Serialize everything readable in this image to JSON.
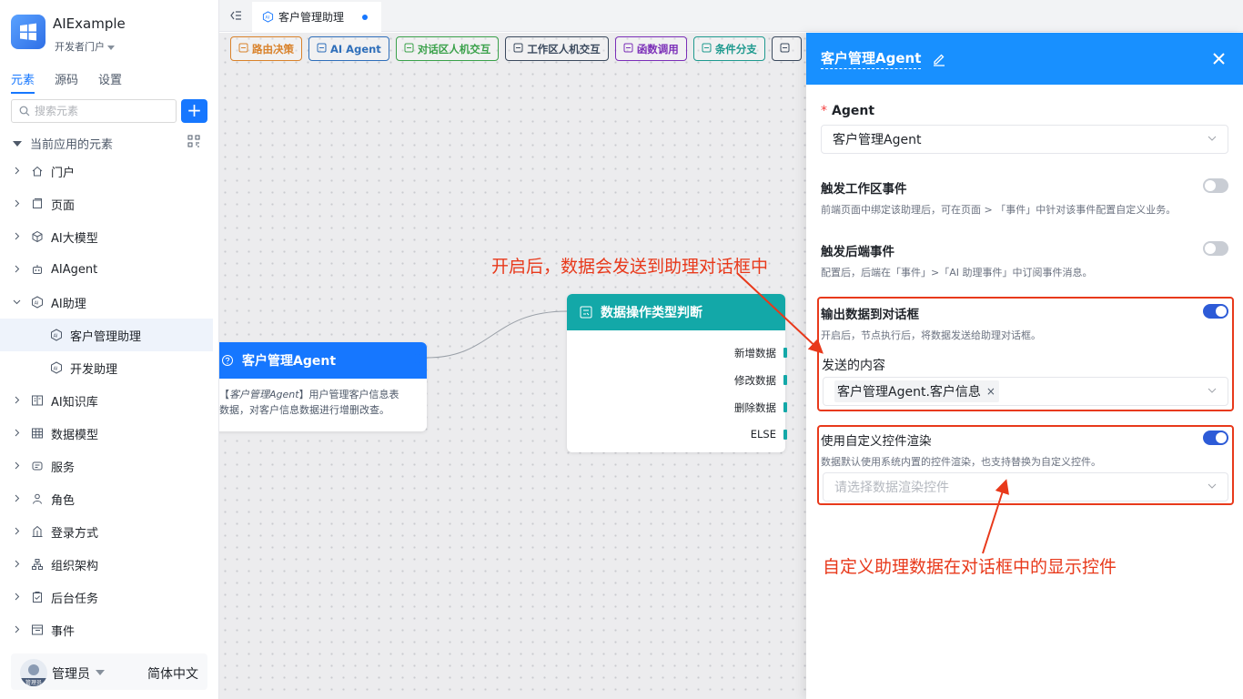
{
  "app": {
    "name": "AIExample",
    "portal": "开发者门户"
  },
  "sidebar": {
    "tabs": [
      "元素",
      "源码",
      "设置"
    ],
    "search_placeholder": "搜索元素",
    "add_label": "+",
    "section_title": "当前应用的元素",
    "items": [
      {
        "label": "门户",
        "icon": "home-icon",
        "expanded": false
      },
      {
        "label": "页面",
        "icon": "page-icon",
        "expanded": false
      },
      {
        "label": "AI大模型",
        "icon": "model-icon",
        "expanded": false
      },
      {
        "label": "AIAgent",
        "icon": "robot-icon",
        "expanded": false
      },
      {
        "label": "AI助理",
        "icon": "ai-assistant-icon",
        "expanded": true
      },
      {
        "label": "客户管理助理",
        "icon": "ai-assistant-icon",
        "child": true,
        "selected": true
      },
      {
        "label": "开发助理",
        "icon": "ai-assistant-icon",
        "child": true
      },
      {
        "label": "AI知识库",
        "icon": "knowledge-icon",
        "expanded": false
      },
      {
        "label": "数据模型",
        "icon": "table-icon",
        "expanded": false
      },
      {
        "label": "服务",
        "icon": "service-icon",
        "expanded": false
      },
      {
        "label": "角色",
        "icon": "role-icon",
        "expanded": false
      },
      {
        "label": "登录方式",
        "icon": "login-icon",
        "expanded": false
      },
      {
        "label": "组织架构",
        "icon": "org-icon",
        "expanded": false
      },
      {
        "label": "后台任务",
        "icon": "task-icon",
        "expanded": false
      },
      {
        "label": "事件",
        "icon": "event-icon",
        "expanded": false
      }
    ],
    "user": {
      "name": "管理员",
      "avatar_caption": "管理员",
      "language": "简体中文"
    }
  },
  "tabs": {
    "active_label": "客户管理助理"
  },
  "toolbar": {
    "chips": [
      {
        "label": "路由决策",
        "color": "#d9822b"
      },
      {
        "label": "AI Agent",
        "color": "#2f6fba"
      },
      {
        "label": "对话区人机交互",
        "color": "#3aa14a"
      },
      {
        "label": "工作区人机交互",
        "color": "#3b4a5e"
      },
      {
        "label": "函数调用",
        "color": "#7b2fb8"
      },
      {
        "label": "条件分支",
        "color": "#1f9a8f"
      },
      {
        "label": "",
        "color": "#3b4a5e"
      }
    ]
  },
  "canvas": {
    "agent_node": {
      "title": "客户管理Agent",
      "desc_italic": "客户管理Agent",
      "desc_prefix": "【",
      "desc_suffix": "】用户管理客户信息表",
      "desc_line2": "数据，对客户信息数据进行增删改查。"
    },
    "judge_node": {
      "title": "数据操作类型判断",
      "branches": [
        "新增数据",
        "修改数据",
        "删除数据",
        "ELSE"
      ]
    },
    "annotation_top": "开启后，数据会发送到助理对话框中",
    "annotation_bottom": "自定义助理数据在对话框中的显示控件"
  },
  "drawer": {
    "title": "客户管理Agent",
    "agent_label": "Agent",
    "agent_value": "客户管理Agent",
    "trigger_ws": {
      "title": "触发工作区事件",
      "desc": "前端页面中绑定该助理后，可在页面 > 「事件」中针对该事件配置自定义业务。",
      "on": false
    },
    "trigger_be": {
      "title": "触发后端事件",
      "desc": "配置后，后端在「事件」>「AI 助理事件」中订阅事件消息。",
      "on": false
    },
    "output": {
      "title": "输出数据到对话框",
      "desc": "开启后，节点执行后，将数据发送给助理对话框。",
      "on": true,
      "content_label": "发送的内容",
      "tag": "客户管理Agent.客户信息"
    },
    "custom_render": {
      "title": "使用自定义控件渲染",
      "desc": "数据默认使用系统内置的控件渲染，也支持替换为自定义控件。",
      "on": true,
      "placeholder": "请选择数据渲染控件"
    }
  },
  "colors": {
    "accent": "#1677ff",
    "drawer_header": "#1890ff",
    "annotation": "#e8391b",
    "judge_node": "#13a8a8"
  }
}
